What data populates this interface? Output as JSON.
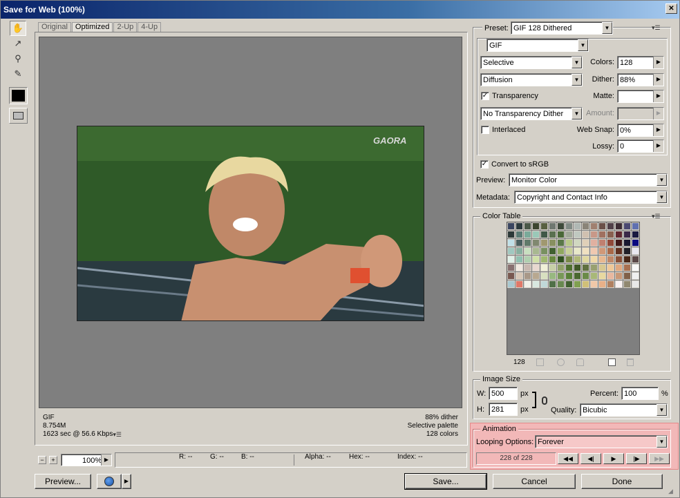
{
  "window": {
    "title": "Save for Web (100%)"
  },
  "tools": [
    {
      "name": "hand-tool-icon",
      "glyph": "✋"
    },
    {
      "name": "slice-select-tool-icon",
      "glyph": "↗"
    },
    {
      "name": "zoom-tool-icon",
      "glyph": "🔍"
    },
    {
      "name": "eyedropper-tool-icon",
      "glyph": "✎"
    }
  ],
  "tabs": [
    "Original",
    "Optimized",
    "2-Up",
    "4-Up"
  ],
  "photo": {
    "watermark": "GAORA"
  },
  "info": {
    "format": "GIF",
    "size": "8.754M",
    "time": "1623 sec @ 56.6 Kbps",
    "dither": "88% dither",
    "palette": "Selective palette",
    "colors": "128 colors"
  },
  "zoom": {
    "value": "100%"
  },
  "status": {
    "r": "R: --",
    "g": "G: --",
    "b": "B: --",
    "alpha": "Alpha: --",
    "hex": "Hex: --",
    "index": "Index: --"
  },
  "buttons": {
    "preview": "Preview...",
    "save": "Save...",
    "cancel": "Cancel",
    "done": "Done"
  },
  "settings": {
    "preset_label": "Preset:",
    "preset": "GIF 128 Dithered",
    "format": "GIF",
    "reduction": "Selective",
    "colors_label": "Colors:",
    "colors": "128",
    "dither_algo": "Diffusion",
    "dither_label": "Dither:",
    "dither": "88%",
    "transparency_label": "Transparency",
    "matte_label": "Matte:",
    "matte": "",
    "transparency_dither": "No Transparency Dither",
    "amount_label": "Amount:",
    "amount": "",
    "interlaced_label": "Interlaced",
    "websnap_label": "Web Snap:",
    "websnap": "0%",
    "lossy_label": "Lossy:",
    "lossy": "0",
    "convert_label": "Convert to sRGB",
    "preview_label": "Preview:",
    "preview": "Monitor Color",
    "metadata_label": "Metadata:",
    "metadata": "Copyright and Contact Info"
  },
  "color_table": {
    "label": "Color Table",
    "count": "128",
    "colors": [
      "#3a4560",
      "#2c3a3e",
      "#4a5848",
      "#3c4630",
      "#586040",
      "#707870",
      "#3e4a3a",
      "#808a84",
      "#b0b8b4",
      "#8a8478",
      "#a08070",
      "#6a5048",
      "#504048",
      "#3c2c34",
      "#4a4870",
      "#6070b0",
      "#2c3838",
      "#5a7a74",
      "#7aaa9a",
      "#9ac8b8",
      "#405848",
      "#5a7050",
      "#4a6838",
      "#a0a898",
      "#c0c8c0",
      "#d0c0b0",
      "#c89888",
      "#a07060",
      "#886050",
      "#602830",
      "#3a2848",
      "#1a1a40",
      "#c0e0e8",
      "#4a6060",
      "#607a6a",
      "#808870",
      "#a09870",
      "#889060",
      "#5a7848",
      "#b8c888",
      "#d0d8c0",
      "#e0d0b8",
      "#e0b0a0",
      "#c08070",
      "#904838",
      "#401818",
      "#181830",
      "#0a0a80",
      "#a0c8c0",
      "#88b0a0",
      "#c8e0c0",
      "#a8b890",
      "#789060",
      "#406030",
      "#90a860",
      "#c8d098",
      "#e8e8c8",
      "#f0e0c0",
      "#f0c8b0",
      "#d09878",
      "#a86848",
      "#603020",
      "#202028",
      "#e8e8f0",
      "#e0f0e8",
      "#90c0b0",
      "#b0d0b0",
      "#d0e0a8",
      "#a0b870",
      "#688840",
      "#305020",
      "#788848",
      "#b0b878",
      "#e0d8a0",
      "#f0d8a8",
      "#e8b890",
      "#c08868",
      "#885038",
      "#482818",
      "#5a4848",
      "#887070",
      "#f0e8e0",
      "#c8b8b0",
      "#e8d8d0",
      "#f0f0d8",
      "#c8d0a8",
      "#90a068",
      "#507030",
      "#405828",
      "#607040",
      "#98a070",
      "#d8c890",
      "#f0c898",
      "#e0a880",
      "#a87050",
      "#f8f8f8",
      "#785850",
      "#d8c8b8",
      "#a89888",
      "#b8a890",
      "#d8e0c0",
      "#98b880",
      "#789858",
      "#588038",
      "#4a6830",
      "#6a8a48",
      "#a8b878",
      "#e8d8a0",
      "#e8b8a0",
      "#c89878",
      "#806048",
      "#f0f0f0",
      "#a8c8d0",
      "#e07868",
      "#f0f0e8",
      "#d8e8e0",
      "#c0d8d8",
      "#507048",
      "#688850",
      "#406030",
      "#80a050",
      "#d0c078",
      "#f0c8a8",
      "#e8b088",
      "#b08060",
      "#f8f0f0",
      "#908870",
      "#e8e8e8"
    ]
  },
  "image_size": {
    "label": "Image Size",
    "w_label": "W:",
    "w": "500",
    "h_label": "H:",
    "h": "281",
    "unit": "px",
    "percent_label": "Percent:",
    "percent": "100",
    "percent_unit": "%",
    "quality_label": "Quality:",
    "quality": "Bicubic"
  },
  "animation": {
    "label": "Animation",
    "looping_label": "Looping Options:",
    "looping": "Forever",
    "frame": "228 of 228"
  }
}
